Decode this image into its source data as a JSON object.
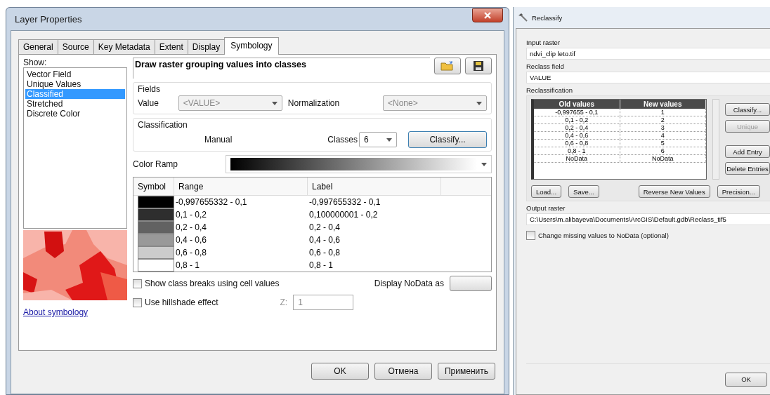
{
  "layer_properties": {
    "title": "Layer Properties",
    "tabs": [
      {
        "label": "General",
        "selected": false
      },
      {
        "label": "Source",
        "selected": false
      },
      {
        "label": "Key Metadata",
        "selected": false
      },
      {
        "label": "Extent",
        "selected": false
      },
      {
        "label": "Display",
        "selected": false
      },
      {
        "label": "Symbology",
        "selected": true
      }
    ],
    "show_label": "Show:",
    "show_items": [
      {
        "label": "Vector Field",
        "selected": false
      },
      {
        "label": "Unique Values",
        "selected": false
      },
      {
        "label": "Classified",
        "selected": true
      },
      {
        "label": "Stretched",
        "selected": false
      },
      {
        "label": "Discrete Color",
        "selected": false
      }
    ],
    "about_link": "About symbology",
    "heading": "Draw raster grouping values into classes",
    "fields": {
      "legend": "Fields",
      "value_label": "Value",
      "value": "<VALUE>",
      "normalization_label": "Normalization",
      "normalization": "<None>"
    },
    "classification": {
      "legend": "Classification",
      "method": "Manual",
      "classes_label": "Classes",
      "classes": "6",
      "classify_button": "Classify..."
    },
    "color_ramp_label": "Color Ramp",
    "table": {
      "columns": [
        "Symbol",
        "Range",
        "Label"
      ],
      "rows": [
        {
          "color": "#000000",
          "range": "-0,997655332 - 0,1",
          "label": "-0,997655332 - 0,1"
        },
        {
          "color": "#2e2e2e",
          "range": "0,1 - 0,2",
          "label": "0,100000001 - 0,2"
        },
        {
          "color": "#626262",
          "range": "0,2 - 0,4",
          "label": "0,2 - 0,4"
        },
        {
          "color": "#999999",
          "range": "0,4 - 0,6",
          "label": "0,4 - 0,6"
        },
        {
          "color": "#cccccc",
          "range": "0,6 - 0,8",
          "label": "0,6 - 0,8"
        },
        {
          "color": "#ffffff",
          "range": "0,8 - 1",
          "label": "0,8 - 1"
        }
      ]
    },
    "checkboxes": [
      {
        "label": "Show class breaks using cell values",
        "checked": false
      },
      {
        "label": "Use hillshade effect",
        "checked": false
      }
    ],
    "nodata_label": "Display NoData as",
    "z_label": "Z:",
    "z_value": "1",
    "buttons": [
      "OK",
      "Отмена",
      "Применить"
    ]
  },
  "reclassify": {
    "title": "Reclassify",
    "input_label": "Input raster",
    "input_value": "ndvi_clip leto.tif",
    "field_label": "Reclass field",
    "field_value": "VALUE",
    "reclassification_label": "Reclassification",
    "table": {
      "columns": [
        "Old values",
        "New values"
      ],
      "rows": [
        {
          "old": "-0,997655 - 0,1",
          "new": "1"
        },
        {
          "old": "0,1 - 0,2",
          "new": "2"
        },
        {
          "old": "0,2 - 0,4",
          "new": "3"
        },
        {
          "old": "0,4 - 0,6",
          "new": "4"
        },
        {
          "old": "0,6 - 0,8",
          "new": "5"
        },
        {
          "old": "0,8 - 1",
          "new": "6"
        },
        {
          "old": "NoData",
          "new": "NoData"
        }
      ]
    },
    "side_buttons": [
      {
        "label": "Classify...",
        "disabled": false
      },
      {
        "label": "Unique",
        "disabled": true
      },
      {
        "label": "Add Entry",
        "disabled": false
      },
      {
        "label": "Delete Entries",
        "disabled": false
      }
    ],
    "bottom_buttons": [
      "Load...",
      "Save...",
      "Reverse New Values",
      "Precision..."
    ],
    "output_label": "Output raster",
    "output_value": "C:\\Users\\m.alibayeva\\Documents\\ArcGIS\\Default.gdb\\Reclass_tif5",
    "checkbox": {
      "label": "Change missing values to NoData (optional)",
      "checked": false
    },
    "ok_button": "OK"
  }
}
